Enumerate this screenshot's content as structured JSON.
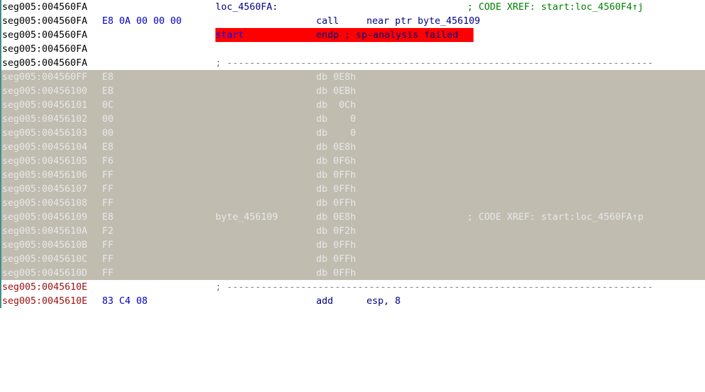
{
  "colors": {
    "address_code": "#000000",
    "address_undef": "#e8e8e8",
    "address_red": "#a01010",
    "bytes_code": "#0000c0",
    "bytes_undef": "#e8e8e8",
    "label": "#0000ff",
    "mnemonic": "#000080",
    "comment": "#008000",
    "comment_undef": "#e8e8e8",
    "undefined_bg": "#c0bcb0",
    "error_bg": "#ff0000",
    "number": "#008000"
  },
  "lines": [
    {
      "addr": "seg005:004560FA",
      "bytes": "",
      "label": "loc_4560FA:",
      "mnem": "",
      "oper": "",
      "cmt": "; CODE XREF: start:loc_4560F4↑j"
    },
    {
      "addr": "seg005:004560FA",
      "bytes": "E8 0A 00 00 00",
      "label": "",
      "mnem": "call",
      "oper": "near ptr byte_456109",
      "cmt": ""
    },
    {
      "addr": "seg005:004560FA",
      "bytes": "",
      "label": "start",
      "mnem": "endp ; sp-analysis failed",
      "oper": "",
      "cmt": ""
    },
    {
      "addr": "seg005:004560FA",
      "bytes": "",
      "label": "",
      "mnem": "",
      "oper": "",
      "cmt": ""
    },
    {
      "addr": "seg005:004560FA",
      "bytes": "",
      "sep": "; ---------------------------------------------------------------------------"
    },
    {
      "addr": "seg005:004560FF",
      "bytes": "E8",
      "label": "",
      "mnem": "db 0E8h",
      "oper": "",
      "cmt": ""
    },
    {
      "addr": "seg005:00456100",
      "bytes": "EB",
      "label": "",
      "mnem": "db 0EBh",
      "oper": "",
      "cmt": ""
    },
    {
      "addr": "seg005:00456101",
      "bytes": "0C",
      "label": "",
      "mnem": "db  0Ch",
      "oper": "",
      "cmt": ""
    },
    {
      "addr": "seg005:00456102",
      "bytes": "00",
      "label": "",
      "mnem": "db    0",
      "oper": "",
      "cmt": ""
    },
    {
      "addr": "seg005:00456103",
      "bytes": "00",
      "label": "",
      "mnem": "db    0",
      "oper": "",
      "cmt": ""
    },
    {
      "addr": "seg005:00456104",
      "bytes": "E8",
      "label": "",
      "mnem": "db 0E8h",
      "oper": "",
      "cmt": ""
    },
    {
      "addr": "seg005:00456105",
      "bytes": "F6",
      "label": "",
      "mnem": "db 0F6h",
      "oper": "",
      "cmt": ""
    },
    {
      "addr": "seg005:00456106",
      "bytes": "FF",
      "label": "",
      "mnem": "db 0FFh",
      "oper": "",
      "cmt": ""
    },
    {
      "addr": "seg005:00456107",
      "bytes": "FF",
      "label": "",
      "mnem": "db 0FFh",
      "oper": "",
      "cmt": ""
    },
    {
      "addr": "seg005:00456108",
      "bytes": "FF",
      "label": "",
      "mnem": "db 0FFh",
      "oper": "",
      "cmt": ""
    },
    {
      "addr": "seg005:00456109",
      "bytes": "E8",
      "label": "byte_456109",
      "mnem": "db 0E8h",
      "oper": "",
      "cmt": "; CODE XREF: start:loc_4560FA↑p"
    },
    {
      "addr": "seg005:0045610A",
      "bytes": "F2",
      "label": "",
      "mnem": "db 0F2h",
      "oper": "",
      "cmt": ""
    },
    {
      "addr": "seg005:0045610B",
      "bytes": "FF",
      "label": "",
      "mnem": "db 0FFh",
      "oper": "",
      "cmt": ""
    },
    {
      "addr": "seg005:0045610C",
      "bytes": "FF",
      "label": "",
      "mnem": "db 0FFh",
      "oper": "",
      "cmt": ""
    },
    {
      "addr": "seg005:0045610D",
      "bytes": "FF",
      "label": "",
      "mnem": "db 0FFh",
      "oper": "",
      "cmt": ""
    },
    {
      "addr": "seg005:0045610E",
      "bytes": "",
      "sep": "; ---------------------------------------------------------------------------"
    },
    {
      "addr": "seg005:0045610E",
      "bytes": "83 C4 08",
      "label": "",
      "mnem": "add",
      "oper": "esp, 8",
      "cmt": ""
    }
  ]
}
